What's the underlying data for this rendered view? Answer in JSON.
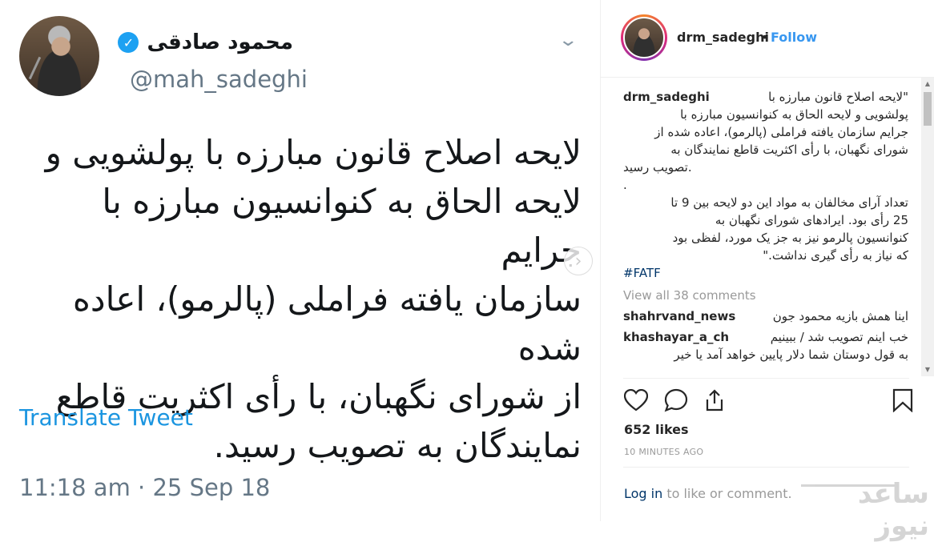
{
  "tweet": {
    "author_name": "محمود صادقی",
    "handle": "@mah_sadeghi",
    "text_lines": [
      "لایحه اصلاح قانون مبارزه با پولشویی و",
      "لایحه الحاق به کنوانسیون مبارزه با جرایم",
      "سازمان یافته فراملی (پالرمو)، اعاده شده",
      "از شورای نگهبان، با رأی اکثریت قاطع",
      "نمایندگان به تصویب رسید."
    ],
    "translate_label": "Translate Tweet",
    "timestamp": "11:18 am · 25 Sep 18"
  },
  "header": {
    "username": "drm_sadeghi",
    "separator": "•",
    "follow_label": "Follow"
  },
  "caption": {
    "username": "drm_sadeghi",
    "first_line": "\"لایحه اصلاح قانون مبارزه با",
    "lines": [
      "پولشویی و لایحه الحاق به کنوانسیون مبارزه با",
      "جرایم سازمان یافته فراملی (پالرمو)، اعاده شده از",
      "شورای نگهبان، با رأی اکثریت قاطع نمایندگان به",
      "تصویب رسید.",
      ".",
      "تعداد آرای مخالفان به مواد این دو لایحه بین 9 تا",
      "25 رأی بود. ایرادهای شورای نگهبان به",
      "کنوانسیون پالرمو نیز به جز یک مورد، لفظی بود",
      "که نیاز به رأی گیری نداشت.\""
    ],
    "hashtag": "#FATF"
  },
  "view_all_comments": "View all 38 comments",
  "comments": [
    {
      "username": "shahrvand_news",
      "text": "اینا همش بازیه محمود جون"
    },
    {
      "username": "khashayar_a_ch",
      "text": "خب اینم تصویب شد / ببینیم"
    },
    {
      "username": "",
      "text": "به قول دوستان شما دلار پایین خواهد آمد یا خیر"
    }
  ],
  "icons": {
    "like": "heart-icon",
    "comment": "comment-icon",
    "share": "share-icon",
    "save": "bookmark-icon"
  },
  "likes": "652 likes",
  "time_ago": "10 MINUTES AGO",
  "login": {
    "link": "Log in",
    "rest": " to like or comment."
  },
  "colors": {
    "instagram_blue": "#3897f0",
    "twitter_blue": "#1da1f2",
    "twitter_link": "#1b95e0"
  }
}
